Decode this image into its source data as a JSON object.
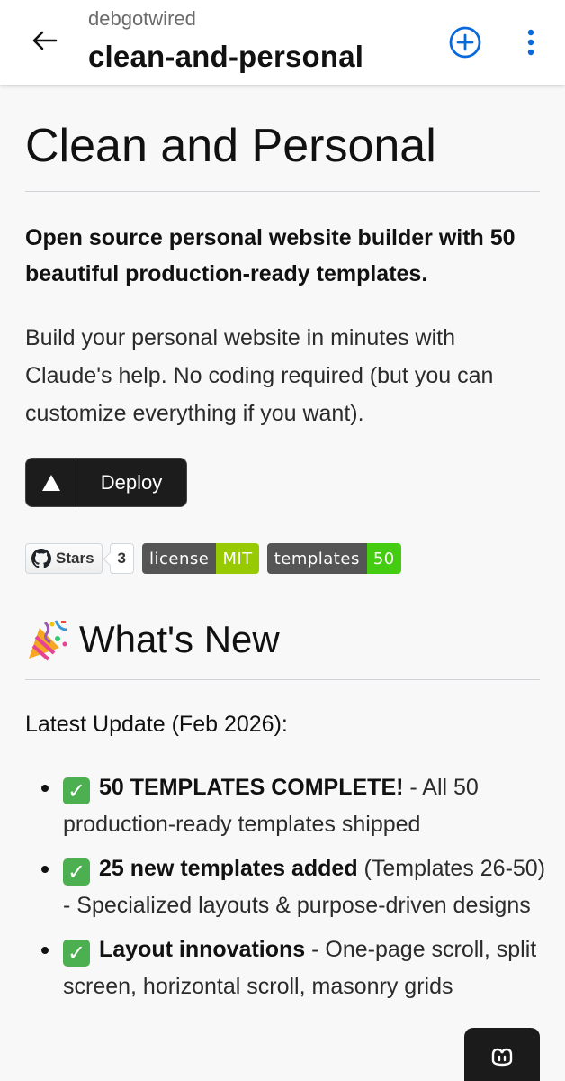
{
  "header": {
    "owner": "debgotwired",
    "repo": "clean-and-personal"
  },
  "readme": {
    "title": "Clean and Personal",
    "tagline": "Open source personal website builder with 50 beautiful production-ready templates.",
    "intro": "Build your personal website in minutes with Claude's help. No coding required (but you can customize everything if you want).",
    "deploy_label": "Deploy",
    "badges": {
      "stars_label": "Stars",
      "stars_count": "3",
      "license_label": "license",
      "license_value": "MIT",
      "license_color": "#97ca00",
      "templates_label": "templates",
      "templates_value": "50",
      "templates_color": "#4c1"
    },
    "whats_new_heading": "What's New",
    "latest_update": "Latest Update (Feb 2026):",
    "updates": [
      {
        "bold": "50 TEMPLATES COMPLETE!",
        "text": " - All 50 production-ready templates shipped"
      },
      {
        "bold": "25 new templates added",
        "text": " (Templates 26-50) - Specialized layouts & purpose-driven designs"
      },
      {
        "bold": "Layout innovations",
        "text": " - One-page scroll, split screen, horizontal scroll, masonry grids"
      }
    ]
  },
  "icons": {
    "back": "arrow-left-icon",
    "add": "plus-circle-icon",
    "more": "kebab-menu-icon",
    "deploy": "triangle-icon",
    "github": "github-icon",
    "party": "party-popper-icon",
    "check": "check-mark-button-icon",
    "copilot": "copilot-icon"
  },
  "colors": {
    "accent": "#0969da",
    "check_green": "#4caf50"
  }
}
